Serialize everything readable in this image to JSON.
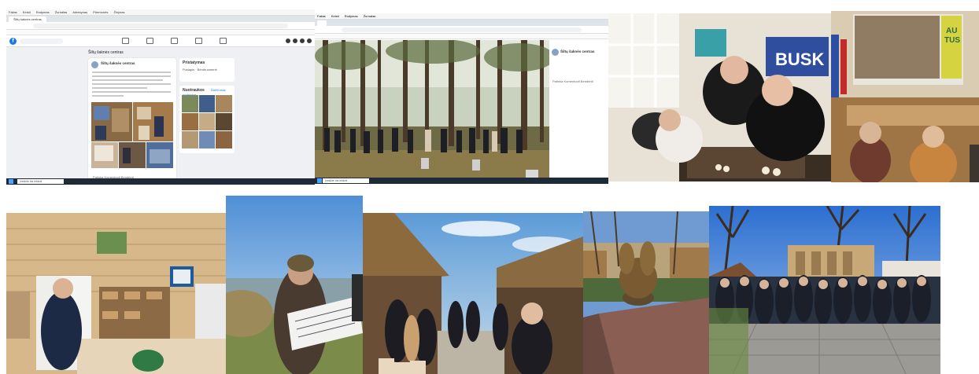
{
  "browser_menu": [
    "Failas",
    "Keisti",
    "Rodymas",
    "Žurnalas",
    "Adresynas",
    "Priemonės",
    "Žinynas"
  ],
  "fb_screenshot": {
    "tab_title": "Šiltų šaknės centras",
    "logo_letter": "f",
    "page_name": "Šiltų šaknės centras",
    "post_author": "Šiltų šaknės centras",
    "post_actions": "Patinka   Komentuoti   Bendrinti",
    "side_intro_title": "Pristatymas",
    "side_intro_line1": "Puslapis · Bendruomenė",
    "side_photos_title": "Nuotraukos",
    "side_photos_link": "Žiūrėti visas nuotraukas",
    "taskbar_search": "Įveskite čia ieškoti"
  },
  "fb_photo_viewer": {
    "panel_title": "Šiltų šaknės centras",
    "panel_actions": "Patinka  Komentuoti  Bendrinti",
    "taskbar_search": "Įveskite čia ieškoti"
  },
  "sign_text": {
    "sign1_line1": "BUSK",
    "sign2_line1": "AU",
    "sign2_line2": "TUS"
  },
  "colors": {
    "facebook_blue": "#1877f2",
    "taskbar": "#1f2a38",
    "sky_blue": "#4f8fd6"
  }
}
